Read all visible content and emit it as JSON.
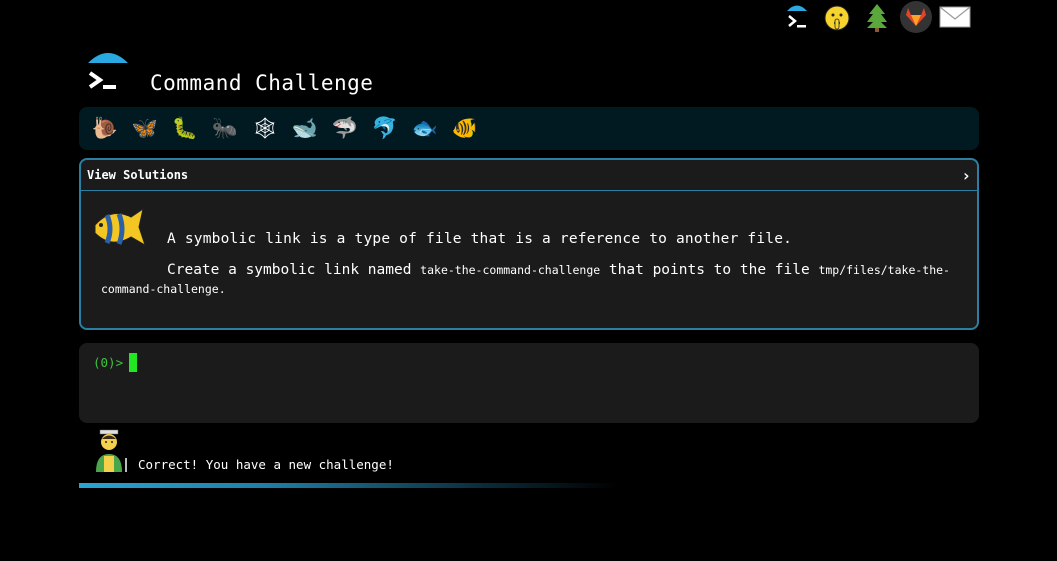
{
  "nav": {
    "items": [
      {
        "name": "terminal-icon"
      },
      {
        "name": "shush-emoji-icon"
      },
      {
        "name": "tree-icon"
      },
      {
        "name": "gitlab-icon"
      },
      {
        "name": "mail-icon"
      }
    ]
  },
  "header": {
    "title": "Command Challenge"
  },
  "levels": [
    {
      "name": "snail-icon",
      "glyph": "🐌"
    },
    {
      "name": "butterfly-icon",
      "glyph": "🦋"
    },
    {
      "name": "caterpillar-icon",
      "glyph": "🐛"
    },
    {
      "name": "ant-icon",
      "glyph": "🐜"
    },
    {
      "name": "spider-web-icon",
      "glyph": "🕸"
    },
    {
      "name": "whale-icon",
      "glyph": "🐋"
    },
    {
      "name": "shark-icon",
      "glyph": "🦈"
    },
    {
      "name": "dolphin-icon",
      "glyph": "🐬"
    },
    {
      "name": "fish-icon",
      "glyph": "🐟"
    },
    {
      "name": "tropical-fish-icon",
      "glyph": "🐠"
    }
  ],
  "challenge": {
    "solutions_label": "View Solutions",
    "chevron": "›",
    "description_1": "A symbolic link is a type of file that is a reference to another file.",
    "description_2_pre": "Create a symbolic link named ",
    "link_name": "take-the-command-challenge",
    "description_2_mid": " that points to the file ",
    "target_path": "tmp/files/take-the-command-challenge",
    "description_2_post": "."
  },
  "terminal": {
    "prompt": "(0)>"
  },
  "status": {
    "message": "Correct! You have a new challenge!"
  },
  "colors": {
    "accent": "#2a7fa3",
    "prompt": "#3ec43e",
    "cursor": "#22e622",
    "level_bar_bg": "#011a22",
    "panel_bg": "#1b1b1b"
  }
}
